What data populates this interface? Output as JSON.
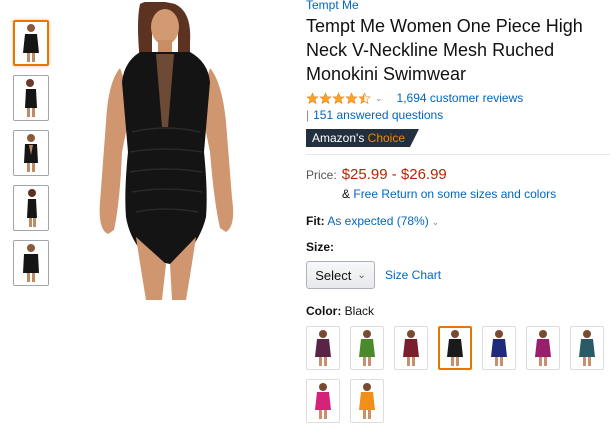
{
  "product": {
    "brand": "Tempt Me",
    "title_lines": [
      "Tempt Me Women One Piece High",
      "Neck V-Neckline Mesh Ruched",
      "Monokini Swimwear"
    ],
    "rating": 4.5,
    "reviews": "1,694 customer reviews",
    "questions": "151 answered questions",
    "badge_prefix": "Amazon's",
    "badge_choice": "Choice"
  },
  "price": {
    "label": "Price:",
    "value": "$25.99 - $26.99",
    "free_return_prefix": "&",
    "free_return": "Free Return on some sizes and colors"
  },
  "fit": {
    "label": "Fit:",
    "value": "As expected (78%)"
  },
  "size": {
    "label": "Size:",
    "select_value": "Select",
    "chart_link": "Size Chart"
  },
  "color": {
    "label": "Color:",
    "selected": "Black",
    "swatches": [
      {
        "name": "Purple",
        "hex": "#5a2446"
      },
      {
        "name": "Green",
        "hex": "#4a8a2a"
      },
      {
        "name": "Wine",
        "hex": "#7a1e2e"
      },
      {
        "name": "Black",
        "hex": "#1a1a1a"
      },
      {
        "name": "Navy",
        "hex": "#1f2a7a"
      },
      {
        "name": "Magenta",
        "hex": "#9a1e6e"
      },
      {
        "name": "Teal",
        "hex": "#2a5a66"
      },
      {
        "name": "Rose",
        "hex": "#d6237a"
      },
      {
        "name": "Orange",
        "hex": "#f0901a"
      }
    ]
  },
  "thumbnails": [
    "front",
    "side",
    "back-open",
    "side-profile",
    "detail"
  ],
  "colors": {
    "link": "#0066c0",
    "price": "#b12704",
    "badge_bg": "#232f3e",
    "badge_choice": "#f08804",
    "star": "#ffa41c",
    "selected_border": "#e77600"
  }
}
